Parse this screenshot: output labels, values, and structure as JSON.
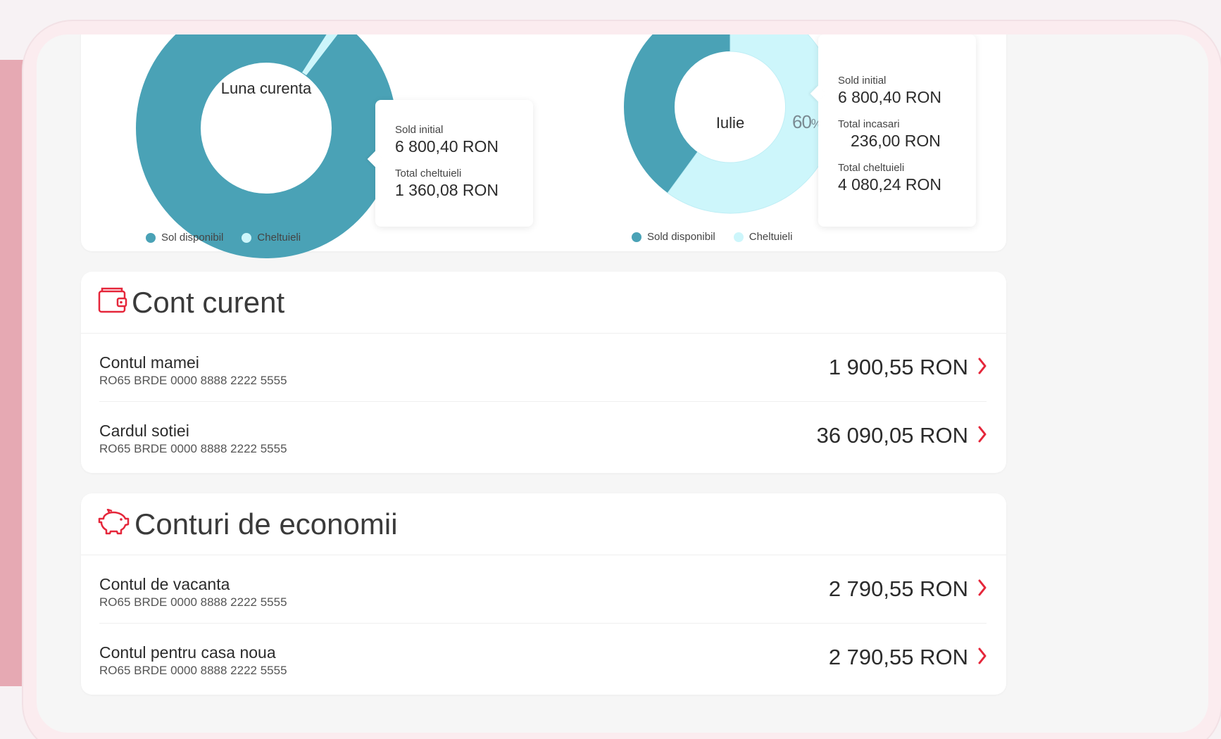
{
  "colors": {
    "accent": "#e5263a",
    "teal": "#4aa2b6",
    "light_cyan": "#cdf6fb",
    "background_pink": "#e6a9b3"
  },
  "current_month_chart": {
    "center_label": "Luna curenta",
    "tooltip": {
      "rows": [
        {
          "label": "Sold initial",
          "value": "6 800,40 RON"
        },
        {
          "label": "Total cheltuieli",
          "value": "1 360,08 RON"
        }
      ]
    },
    "legend": [
      {
        "label": "Sol disponibil",
        "color": "#4aa2b6"
      },
      {
        "label": "Cheltuieli",
        "color": "#cdf6fb"
      }
    ]
  },
  "july_chart": {
    "center_label": "Iulie",
    "percent_value": "60",
    "percent_sign": "%",
    "tooltip": {
      "rows": [
        {
          "label": "Sold initial",
          "value": "6 800,40 RON"
        },
        {
          "label": "Total incasari",
          "value": "236,00 RON"
        },
        {
          "label": "Total cheltuieli",
          "value": "4 080,24 RON"
        }
      ]
    },
    "legend": [
      {
        "label": "Sold disponibil",
        "color": "#4aa2b6"
      },
      {
        "label": "Cheltuieli",
        "color": "#cdf6fb"
      }
    ]
  },
  "chart_data": [
    {
      "type": "pie",
      "categories": [
        "Sol disponibil",
        "Cheltuieli"
      ],
      "values": [
        98,
        2
      ]
    },
    {
      "type": "pie",
      "categories": [
        "Sold disponibil",
        "Cheltuieli"
      ],
      "values": [
        40,
        60
      ]
    }
  ],
  "current_accounts": {
    "title": "Cont curent",
    "icon": "wallet-icon",
    "rows": [
      {
        "name": "Contul mamei",
        "iban": "RO65 BRDE 0000 8888 2222 5555",
        "amount": "1 900,55 RON"
      },
      {
        "name": "Cardul sotiei",
        "iban": "RO65 BRDE 0000 8888 2222 5555",
        "amount": "36 090,05 RON"
      }
    ]
  },
  "savings_accounts": {
    "title": "Conturi de economii",
    "icon": "piggy-bank-icon",
    "rows": [
      {
        "name": "Contul de vacanta",
        "iban": "RO65 BRDE 0000 8888 2222 5555",
        "amount": "2 790,55 RON"
      },
      {
        "name": "Contul pentru casa noua",
        "iban": "RO65 BRDE 0000 8888 2222 5555",
        "amount": "2 790,55 RON"
      }
    ]
  }
}
